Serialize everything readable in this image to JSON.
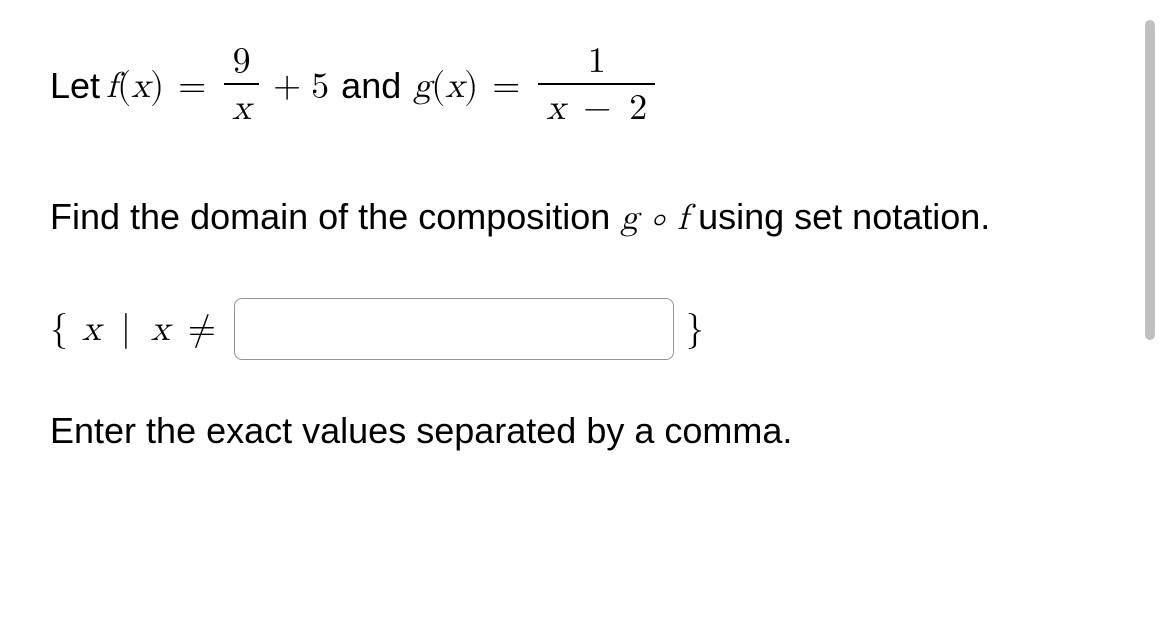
{
  "question": {
    "let_word": "Let",
    "f_name": "f",
    "g_name": "g",
    "var": "x",
    "eq": "=",
    "f_frac_num": "9",
    "f_frac_den": "x",
    "f_tail_plus": "+",
    "f_tail_const": "5",
    "and_word": "and",
    "g_frac_num": "1",
    "g_frac_den_pre": "x",
    "g_frac_den_op": "−",
    "g_frac_den_const": "2"
  },
  "instruction_part1": "Find the domain of the composition ",
  "instruction_comp": "g ∘ f",
  "instruction_part2": " using set notation.",
  "answer_prefix_open": "{",
  "answer_prefix_x1": "x",
  "answer_prefix_bar": "∣",
  "answer_prefix_x2": "x",
  "answer_prefix_neq": "≠",
  "answer_suffix": "}",
  "input_value": "",
  "hint": "Enter the exact values separated by a comma.",
  "chart_data": {
    "type": "table",
    "problem": "domain of composition g ∘ f",
    "f": "9/x + 5",
    "g": "1/(x - 2)"
  }
}
